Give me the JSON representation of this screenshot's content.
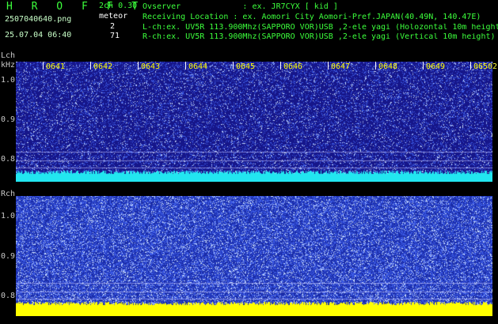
{
  "header": {
    "app_title": "H R O F F T",
    "mode": "2ch 0.30",
    "filename": "2507040640.png",
    "datetime": "25.07.04 06:40",
    "meteor_label": "meteor",
    "meteor_lch": "2",
    "meteor_rch": "71",
    "observer": "Ovserver             : ex. JR7CYX [ kid ]",
    "location": "Receiving Location : ex. Aomori City Aomori-Pref.JAPAN(40.49N, 140.47E)",
    "lch_info": "L-ch:ex. UV5R 113.900Mhz(SAPPORO VOR)USB ,2-ele yagi (Holozontal 10m height",
    "rch_info": "R-ch:ex. UV5R 113.900Mhz(SAPPORO VOR)USB ,2-ele yagi (Vertical 10m height)"
  },
  "time_ticks": [
    "0641",
    "0642",
    "0643",
    "0644",
    "0645",
    "0646",
    "0647",
    "0648",
    "0649",
    "0650"
  ],
  "lch_panel": {
    "label": "Lch",
    "unit": "kHz",
    "y_ticks": [
      "1.0",
      "0.9",
      "0.8"
    ],
    "right_marker": "2"
  },
  "rch_panel": {
    "label": "Rch",
    "y_ticks": [
      "1.0",
      "0.9",
      "0.8"
    ]
  },
  "colors": {
    "lch_background": "#16168a",
    "rch_background": "#1a2ca8",
    "baseline_lch": "#22e6f0",
    "baseline_rch": "#ffff00",
    "tick_text": "#ffff00",
    "header_green": "#3cff3c"
  }
}
